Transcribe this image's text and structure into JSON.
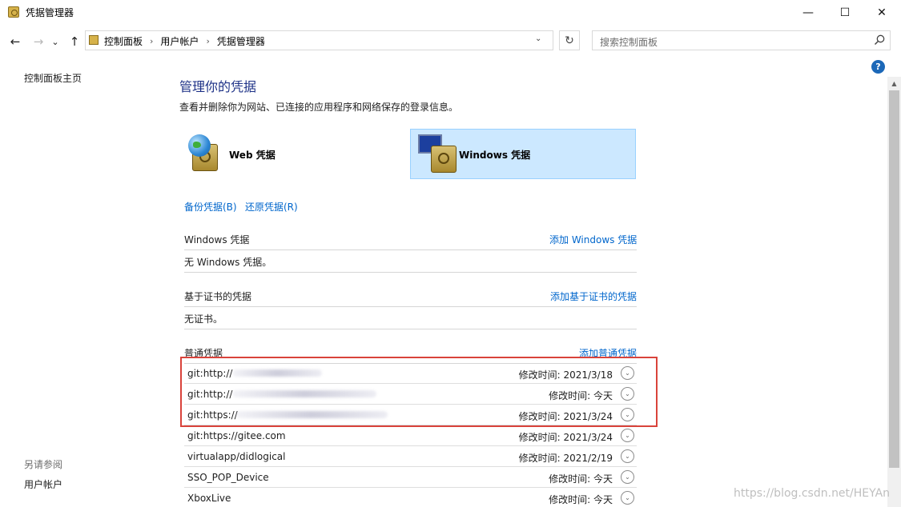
{
  "window": {
    "title": "凭据管理器",
    "minimize_glyph": "—",
    "maximize_glyph": "☐",
    "close_glyph": "✕"
  },
  "nav": {
    "back_glyph": "←",
    "forward_glyph": "→",
    "recent_glyph": "⌄",
    "up_glyph": "↑",
    "refresh_glyph": "↻",
    "dropdown_glyph": "⌄"
  },
  "breadcrumb": [
    "控制面板",
    "用户帐户",
    "凭据管理器"
  ],
  "breadcrumb_sep": "›",
  "search": {
    "placeholder": "搜索控制面板"
  },
  "help_glyph": "?",
  "scroll_up_glyph": "▲",
  "left_pane": {
    "home_link": "控制面板主页",
    "see_also": "另请参阅",
    "user_accounts": "用户帐户"
  },
  "main": {
    "heading": "管理你的凭据",
    "subtitle": "查看并删除你为网站、已连接的应用程序和网络保存的登录信息。",
    "tiles": [
      {
        "label": "Web 凭据",
        "selected": false
      },
      {
        "label": "Windows 凭据",
        "selected": true
      }
    ],
    "backup_link": "备份凭据(B)",
    "restore_link": "还原凭据(R)",
    "windows_section": {
      "title": "Windows 凭据",
      "add_link": "添加 Windows 凭据",
      "empty_text": "无 Windows 凭据。"
    },
    "cert_section": {
      "title": "基于证书的凭据",
      "add_link": "添加基于证书的凭据",
      "empty_text": "无证书。"
    },
    "generic_section": {
      "title": "普通凭据",
      "add_link": "添加普通凭据",
      "expand_glyph": "⌄",
      "items": [
        {
          "name": "git:http://",
          "modified_label": "修改时间:",
          "modified": "2021/3/18"
        },
        {
          "name": "git:http://",
          "modified_label": "修改时间:",
          "modified": "今天"
        },
        {
          "name": "git:https://",
          "modified_label": "修改时间:",
          "modified": "2021/3/24"
        },
        {
          "name": "git:https://gitee.com",
          "modified_label": "修改时间:",
          "modified": "2021/3/24"
        },
        {
          "name": "virtualapp/didlogical",
          "modified_label": "修改时间:",
          "modified": "2021/2/19"
        },
        {
          "name": "SSO_POP_Device",
          "modified_label": "修改时间:",
          "modified": "今天"
        },
        {
          "name": "XboxLive",
          "modified_label": "修改时间:",
          "modified": "今天"
        }
      ]
    }
  },
  "watermark": "https://blog.csdn.net/HEYAn",
  "colors": {
    "link": "#0066cc",
    "heading": "#1e3287",
    "selected_tile": "#cce8ff",
    "highlight_box": "#d9433b"
  }
}
